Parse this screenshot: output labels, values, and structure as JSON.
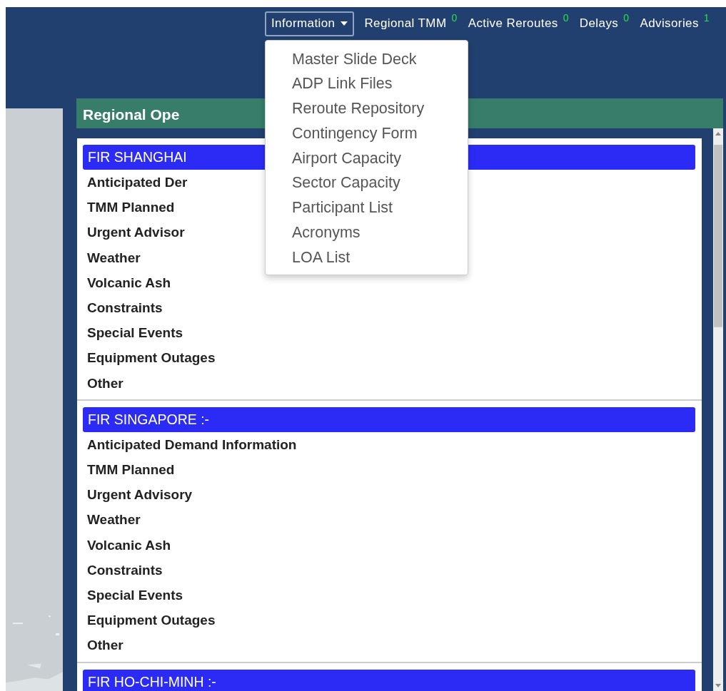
{
  "nav": {
    "menu": {
      "label": "Information",
      "expanded": true,
      "items": [
        "Master Slide Deck",
        "ADP Link Files",
        "Reroute Repository",
        "Contingency Form",
        "Airport Capacity",
        "Sector Capacity",
        "Participant List",
        "Acronyms",
        "LOA List"
      ]
    },
    "links": [
      {
        "label": "Regional TMM",
        "count": "0"
      },
      {
        "label": "Active Reroutes",
        "count": "0"
      },
      {
        "label": "Delays",
        "count": "0"
      },
      {
        "label": "Advisories",
        "count": "1"
      }
    ]
  },
  "panel": {
    "title": "Regional Ope",
    "sections": [
      {
        "title": "FIR SHANGHAI",
        "items": [
          "Anticipated Der",
          "TMM Planned",
          "Urgent Advisor",
          "Weather",
          "Volcanic Ash",
          "Constraints",
          "Special Events",
          "Equipment Outages",
          "Other"
        ]
      },
      {
        "title": "FIR SINGAPORE :-",
        "items": [
          "Anticipated Demand Information",
          "TMM Planned",
          "Urgent Advisory",
          "Weather",
          "Volcanic Ash",
          "Constraints",
          "Special Events",
          "Equipment Outages",
          "Other"
        ]
      },
      {
        "title": "FIR HO-CHI-MINH :-"
      }
    ]
  }
}
